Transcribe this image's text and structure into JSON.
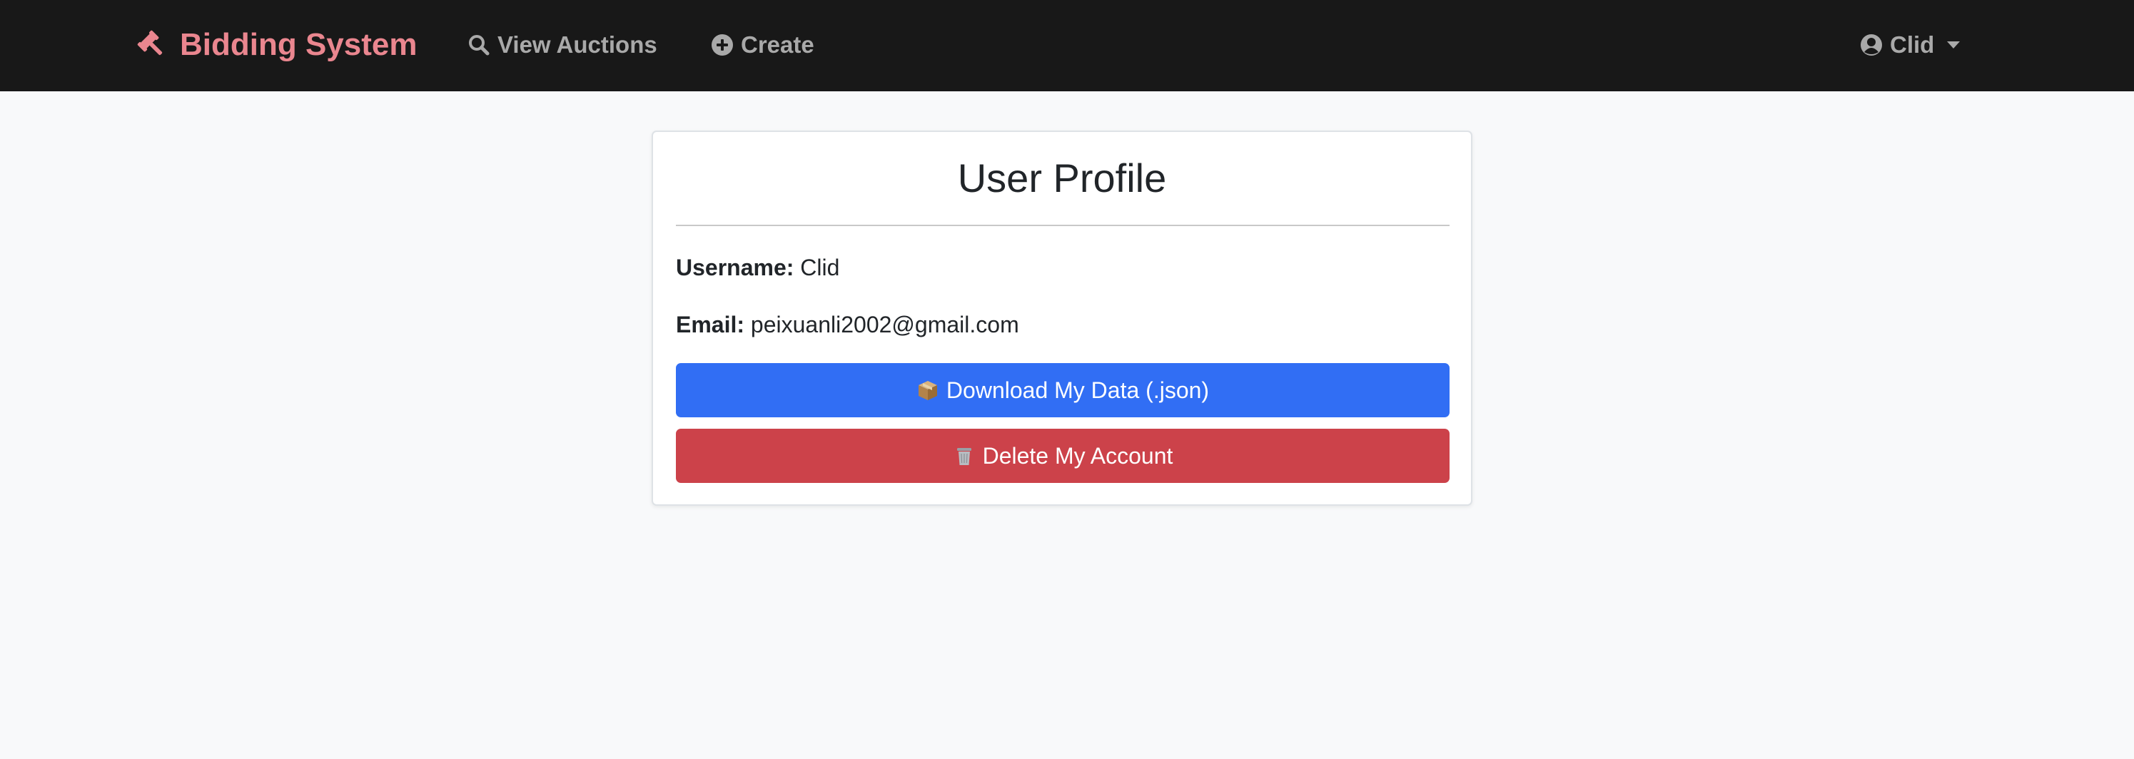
{
  "navbar": {
    "brand": "Bidding System",
    "brand_icon": "gavel-icon",
    "brand_color": "#ea868f",
    "links": [
      {
        "label": "View Auctions",
        "icon": "search-icon"
      },
      {
        "label": "Create",
        "icon": "plus-circle-icon"
      }
    ],
    "user_menu": {
      "label": "Clid",
      "icon": "user-circle-icon"
    }
  },
  "profile": {
    "title": "User Profile",
    "username_label": "Username:",
    "username": "Clid",
    "email_label": "Email:",
    "email": "peixuanli2002@gmail.com",
    "download_label": "Download My Data (.json)",
    "download_icon": "package-icon",
    "delete_label": "Delete My Account",
    "delete_icon": "wastebasket-icon"
  },
  "colors": {
    "primary": "#316ef4",
    "danger": "#cc424a",
    "navbar_bg": "#181818",
    "page_bg": "#f8f9fa"
  }
}
